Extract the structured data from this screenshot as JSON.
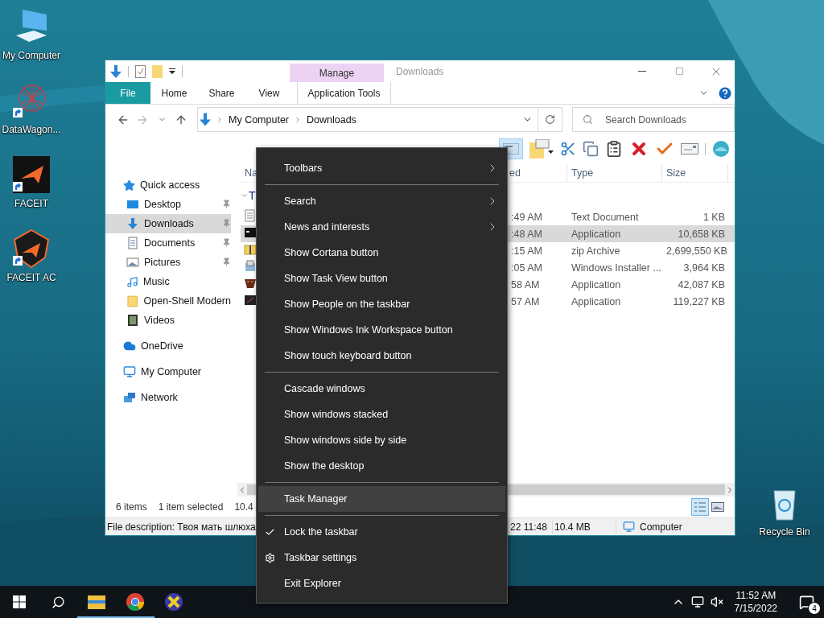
{
  "desktop": {
    "left_icons": [
      {
        "label": "My Computer",
        "kind": "computer",
        "shortcut": false
      },
      {
        "label": "DataWagon...",
        "kind": "web",
        "shortcut": true
      },
      {
        "label": "FACEIT",
        "kind": "faceit",
        "shortcut": true
      },
      {
        "label": "FACEIT AC",
        "kind": "shield",
        "shortcut": true
      }
    ],
    "right_icons": [
      {
        "label": "Recycle Bin",
        "kind": "bin",
        "shortcut": false
      }
    ]
  },
  "explorer": {
    "title": "Downloads",
    "context_group": "Manage",
    "context_tab": "Application Tools",
    "ribbon_tabs": [
      {
        "label": "File",
        "kind": "file"
      },
      {
        "label": "Home",
        "kind": "tab"
      },
      {
        "label": "Share",
        "kind": "tab"
      },
      {
        "label": "View",
        "kind": "tab"
      }
    ],
    "address": {
      "crumbs": [
        "My Computer",
        "Downloads"
      ]
    },
    "search": {
      "placeholder": "Search Downloads"
    },
    "nav": [
      {
        "label": "Quick access",
        "kind": "star",
        "selected": false,
        "pinned": false,
        "children": [
          {
            "label": "Desktop",
            "kind": "desktop",
            "selected": false,
            "pinned": true
          },
          {
            "label": "Downloads",
            "kind": "downloads",
            "selected": true,
            "pinned": true
          },
          {
            "label": "Documents",
            "kind": "documents",
            "selected": false,
            "pinned": true
          },
          {
            "label": "Pictures",
            "kind": "pictures",
            "selected": false,
            "pinned": true
          },
          {
            "label": "Music",
            "kind": "music",
            "selected": false,
            "pinned": false
          },
          {
            "label": "Open-Shell Modern",
            "kind": "folder",
            "selected": false,
            "pinned": false
          },
          {
            "label": "Videos",
            "kind": "videos",
            "selected": false,
            "pinned": false
          }
        ]
      },
      {
        "label": "OneDrive",
        "kind": "cloud",
        "selected": false,
        "pinned": false
      },
      {
        "label": "My Computer",
        "kind": "computer",
        "selected": false,
        "pinned": false
      },
      {
        "label": "Network",
        "kind": "network",
        "selected": false,
        "pinned": false
      }
    ],
    "columns": [
      "Na",
      "ed",
      "Type",
      "Size"
    ],
    "group": {
      "label": "T",
      "expanded": true
    },
    "rows": [
      {
        "kind": "text",
        "date": ":49 AM",
        "type": "Text Document",
        "size": "1 KB",
        "selected": false
      },
      {
        "kind": "console",
        "date": ":48 AM",
        "type": "Application",
        "size": "10,658 KB",
        "selected": true
      },
      {
        "kind": "zip",
        "date": ":15 AM",
        "type": "zip Archive",
        "size": "2,699,550 KB",
        "selected": false
      },
      {
        "kind": "installer",
        "date": ":05 AM",
        "type": "Windows Installer ...",
        "size": "3,964 KB",
        "selected": false
      },
      {
        "kind": "mask",
        "date": "58 AM",
        "type": "Application",
        "size": "42,087 KB",
        "selected": false
      },
      {
        "kind": "dark",
        "date": "57 AM",
        "type": "Application",
        "size": "119,227 KB",
        "selected": false
      }
    ],
    "item_count": "6 items",
    "selection": "1 item selected",
    "selection_size": "10.4",
    "view_buttons": [
      {
        "kind": "details",
        "selected": true
      },
      {
        "kind": "large",
        "selected": false
      }
    ],
    "status_bar": {
      "description": "File description: Твоя мать шлюха,",
      "date": "22 11:48",
      "size": "10.4 MB",
      "location": "Computer"
    }
  },
  "menu": {
    "groups": [
      [
        {
          "label": "Toolbars",
          "kind": "submenu",
          "checked": false,
          "selected": false
        }
      ],
      [
        {
          "label": "Search",
          "kind": "submenu",
          "checked": false,
          "selected": false
        },
        {
          "label": "News and interests",
          "kind": "submenu",
          "checked": false,
          "selected": false
        },
        {
          "label": "Show Cortana button",
          "kind": "command",
          "checked": false,
          "selected": false
        },
        {
          "label": "Show Task View button",
          "kind": "command",
          "checked": false,
          "selected": false
        },
        {
          "label": "Show People on the taskbar",
          "kind": "command",
          "checked": false,
          "selected": false
        },
        {
          "label": "Show Windows Ink Workspace button",
          "kind": "command",
          "checked": false,
          "selected": false
        },
        {
          "label": "Show touch keyboard button",
          "kind": "command",
          "checked": false,
          "selected": false
        }
      ],
      [
        {
          "label": "Cascade windows",
          "kind": "command",
          "checked": false,
          "selected": false
        },
        {
          "label": "Show windows stacked",
          "kind": "command",
          "checked": false,
          "selected": false
        },
        {
          "label": "Show windows side by side",
          "kind": "command",
          "checked": false,
          "selected": false
        },
        {
          "label": "Show the desktop",
          "kind": "command",
          "checked": false,
          "selected": false
        }
      ],
      [
        {
          "label": "Task Manager",
          "kind": "command",
          "checked": false,
          "selected": true
        }
      ],
      [
        {
          "label": "Lock the taskbar",
          "kind": "command",
          "checked": true,
          "selected": false
        },
        {
          "label": "Taskbar settings",
          "kind": "settings",
          "checked": false,
          "selected": false
        },
        {
          "label": "Exit Explorer",
          "kind": "command",
          "checked": false,
          "selected": false
        }
      ]
    ]
  },
  "taskbar": {
    "apps": [
      {
        "kind": "explorer",
        "running": true
      },
      {
        "kind": "chrome",
        "running": true
      },
      {
        "kind": "xapp",
        "running": false
      }
    ],
    "time": "11:52 AM",
    "date": "7/15/2022",
    "notifications": "4"
  }
}
